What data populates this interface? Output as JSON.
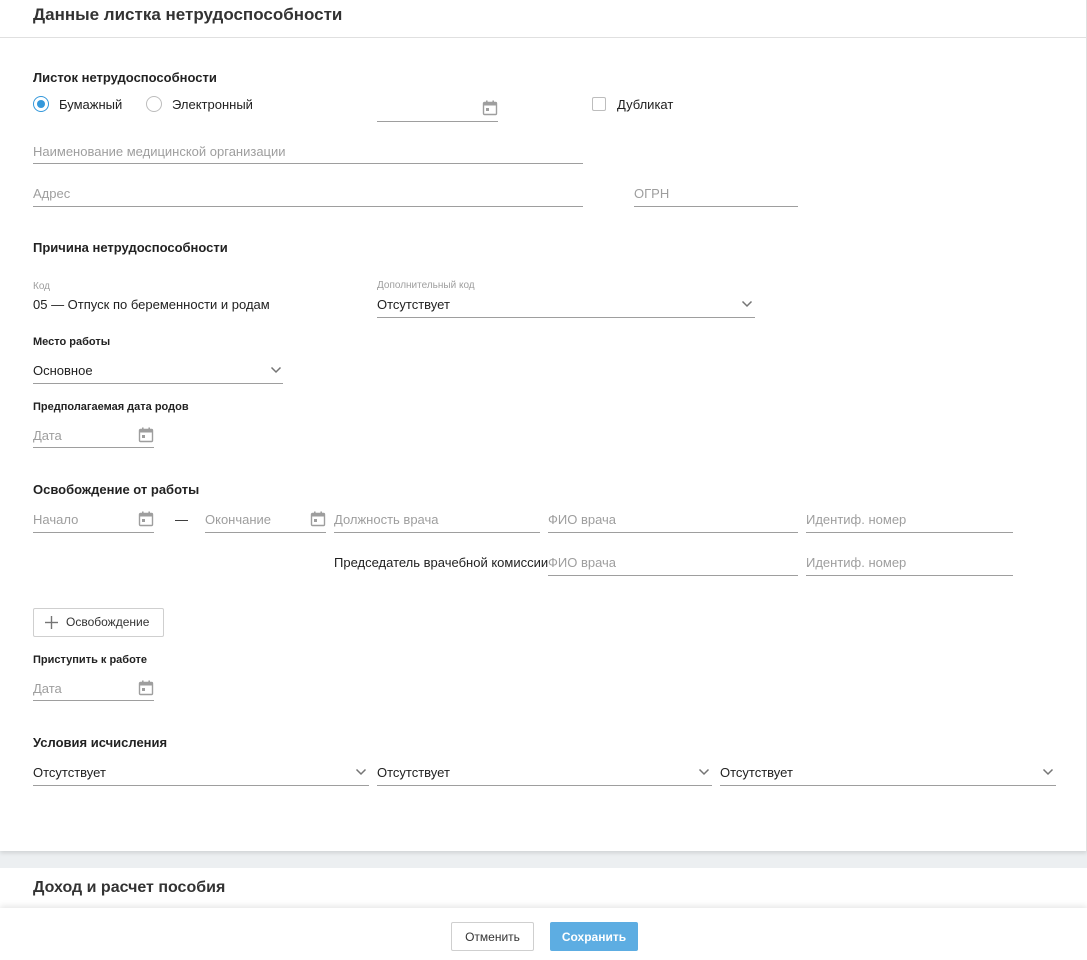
{
  "sheet": {
    "title": "Данные листка нетрудоспособности",
    "sheet_section": {
      "title": "Листок нетрудоспособности",
      "radio_paper": "Бумажный",
      "radio_electronic": "Электронный",
      "selected": "paper",
      "duplicate_label": "Дубликат",
      "org_name_placeholder": "Наименование медицинской организации",
      "address_placeholder": "Адрес",
      "ogrn_placeholder": "ОГРН"
    },
    "reason": {
      "title": "Причина нетрудоспособности",
      "code_label": "Код",
      "code_value": "05 — Отпуск по беременности и родам",
      "extra_code_label": "Дополнительный код",
      "extra_code_value": "Отсутствует"
    },
    "workplace": {
      "label": "Место работы",
      "value": "Основное"
    },
    "due_date": {
      "label": "Предполагаемая дата родов",
      "placeholder": "Дата"
    },
    "release": {
      "title": "Освобождение от работы",
      "start_placeholder": "Начало",
      "dash": "—",
      "end_placeholder": "Окончание",
      "doctor_position_placeholder": "Должность врача",
      "doctor_name_placeholder": "ФИО врача",
      "doctor_id_placeholder": "Идентиф. номер",
      "chairman_label": "Председатель врачебной комиссии",
      "chairman_name_placeholder": "ФИО врача",
      "chairman_id_placeholder": "Идентиф. номер",
      "add_button": "Освобождение"
    },
    "return_to_work": {
      "label": "Приступить к работе",
      "placeholder": "Дата"
    },
    "calc_conditions": {
      "title": "Условия исчисления",
      "values": [
        "Отсутствует",
        "Отсутствует",
        "Отсутствует"
      ]
    }
  },
  "income": {
    "title": "Доход и расчет пособия"
  },
  "footer": {
    "cancel": "Отменить",
    "save": "Сохранить"
  },
  "colors": {
    "accent": "#3498db",
    "save_button": "#5dade2"
  }
}
